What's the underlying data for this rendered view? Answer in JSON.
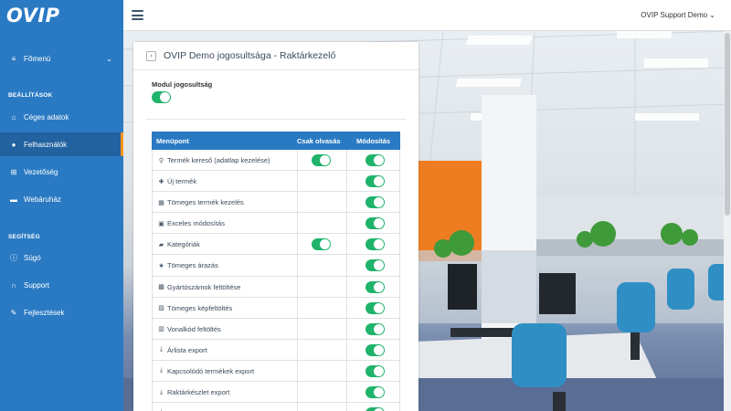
{
  "app": {
    "logo": "OVIP",
    "user": "OVIP Support Demo"
  },
  "colors": {
    "sidebar": "#2a7ac3",
    "accent": "#f7941d",
    "toggle_on": "#1fb36b"
  },
  "sidebar": {
    "menu_label": "Főmenü",
    "section_settings": "BEÁLLÍTÁSOK",
    "section_help": "SEGÍTSÉG",
    "items": [
      {
        "label": "Céges adatok",
        "icon": "home-icon"
      },
      {
        "label": "Felhasználók",
        "icon": "users-icon",
        "active": true
      },
      {
        "label": "Vezetőség",
        "icon": "sitemap-icon"
      },
      {
        "label": "Webáruház",
        "icon": "cart-icon"
      },
      {
        "label": "Súgó",
        "icon": "info-icon"
      },
      {
        "label": "Support",
        "icon": "headset-icon"
      },
      {
        "label": "Fejlesztések",
        "icon": "wrench-icon"
      }
    ]
  },
  "card": {
    "title": "OVIP Demo jogosultsága - Raktárkezelő",
    "module_label": "Modul jogosultság",
    "module_enabled": true,
    "table": {
      "headers": [
        "Menüpont",
        "Csak olvasás",
        "Módosítás"
      ],
      "rows": [
        {
          "name": "Termék kereső (adatlap kezelése)",
          "icon": "search-icon",
          "read": true,
          "write": true
        },
        {
          "name": "Új termék",
          "icon": "plus-icon",
          "read": false,
          "write": true
        },
        {
          "name": "Tömeges termék kezelés",
          "icon": "table-icon",
          "read": false,
          "write": true
        },
        {
          "name": "Exceles módosítás",
          "icon": "excel-icon",
          "read": false,
          "write": true
        },
        {
          "name": "Kategóriák",
          "icon": "folder-icon",
          "read": true,
          "write": true
        },
        {
          "name": "Tömeges árazás",
          "icon": "star-icon",
          "read": false,
          "write": true
        },
        {
          "name": "Gyártószámok feltöltése",
          "icon": "grid-icon",
          "read": false,
          "write": true
        },
        {
          "name": "Tömeges képfeltöltés",
          "icon": "image-icon",
          "read": false,
          "write": true
        },
        {
          "name": "Vonalkód feltöltés",
          "icon": "barcode-icon",
          "read": false,
          "write": true
        },
        {
          "name": "Árlista export",
          "icon": "download-icon",
          "read": false,
          "write": true
        },
        {
          "name": "Kapcsolódó termékek export",
          "icon": "download-icon",
          "read": false,
          "write": true
        },
        {
          "name": "Raktárkészlet export",
          "icon": "download-icon",
          "read": false,
          "write": true
        },
        {
          "name": "",
          "icon": "download-icon",
          "read": false,
          "write": true
        }
      ]
    }
  }
}
